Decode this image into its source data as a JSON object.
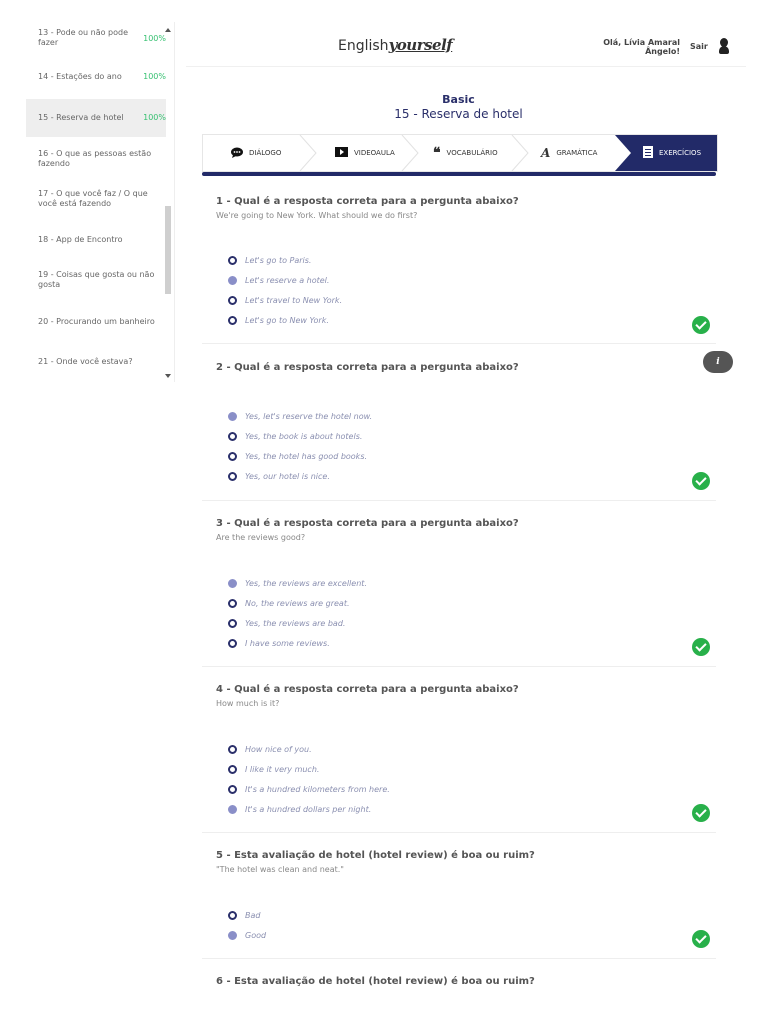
{
  "sidebar": {
    "items": [
      {
        "label": "13 - Pode ou não pode fazer",
        "pct": "100%"
      },
      {
        "label": "14 - Estações do ano",
        "pct": "100%"
      },
      {
        "label": "15 - Reserva de hotel",
        "pct": "100%"
      },
      {
        "label": "16 - O que as pessoas estão fazendo",
        "pct": ""
      },
      {
        "label": "17 - O que você faz / O que você está fazendo",
        "pct": ""
      },
      {
        "label": "18 - App de Encontro",
        "pct": ""
      },
      {
        "label": "19 - Coisas que gosta ou não gosta",
        "pct": ""
      },
      {
        "label": "20 - Procurando um banheiro",
        "pct": ""
      },
      {
        "label": "21 - Onde você estava?",
        "pct": ""
      }
    ]
  },
  "header": {
    "brand_plain": "English",
    "brand_script": "yourself",
    "user_line1": "Olá, Lívia Amaral",
    "user_line2": "Ângelo!",
    "logout": "Sair"
  },
  "lesson": {
    "level": "Basic",
    "title": "15 - Reserva de hotel"
  },
  "tabs": [
    {
      "label": "DIÁLOGO",
      "icon": "chat-icon"
    },
    {
      "label": "VIDEOAULA",
      "icon": "play-icon"
    },
    {
      "label": "VOCABULÁRIO",
      "icon": "quote-icon"
    },
    {
      "label": "GRAMÁTICA",
      "icon": "grammar-icon"
    },
    {
      "label": "EXERCÍCIOS",
      "icon": "list-icon"
    }
  ],
  "questions": [
    {
      "title": "1 - Qual é a resposta correta para a pergunta abaixo?",
      "sub": "We're going to New York. What should we do first?",
      "options": [
        "Let's go to Paris.",
        "Let's reserve a hotel.",
        "Let's travel to New York.",
        "Let's go to New York."
      ],
      "selected": 1
    },
    {
      "title": "2 - Qual é a resposta correta para a pergunta abaixo?",
      "sub": "",
      "options": [
        "Yes, let's reserve the hotel now.",
        "Yes, the book is about hotels.",
        "Yes, the hotel has good books.",
        "Yes, our hotel is nice."
      ],
      "selected": 0
    },
    {
      "title": "3 - Qual é a resposta correta para a pergunta abaixo?",
      "sub": "Are the reviews good?",
      "options": [
        "Yes, the reviews are excellent.",
        "No, the reviews are great.",
        "Yes, the reviews are bad.",
        "I have some reviews."
      ],
      "selected": 0
    },
    {
      "title": "4 - Qual é a resposta correta para a pergunta abaixo?",
      "sub": "How much is it?",
      "options": [
        "How nice of you.",
        "I like it very much.",
        "It's a hundred kilometers from here.",
        "It's a hundred dollars per night."
      ],
      "selected": 3
    },
    {
      "title": "5 - Esta avaliação de hotel (hotel review) é boa ou ruim?",
      "sub": "\"The hotel was clean and neat.\"",
      "options": [
        "Bad",
        "Good"
      ],
      "selected": 1
    },
    {
      "title": "6 - Esta avaliação de hotel (hotel review) é boa ou ruim?",
      "sub": "",
      "options": [],
      "selected": -1
    }
  ],
  "info_label": "i"
}
